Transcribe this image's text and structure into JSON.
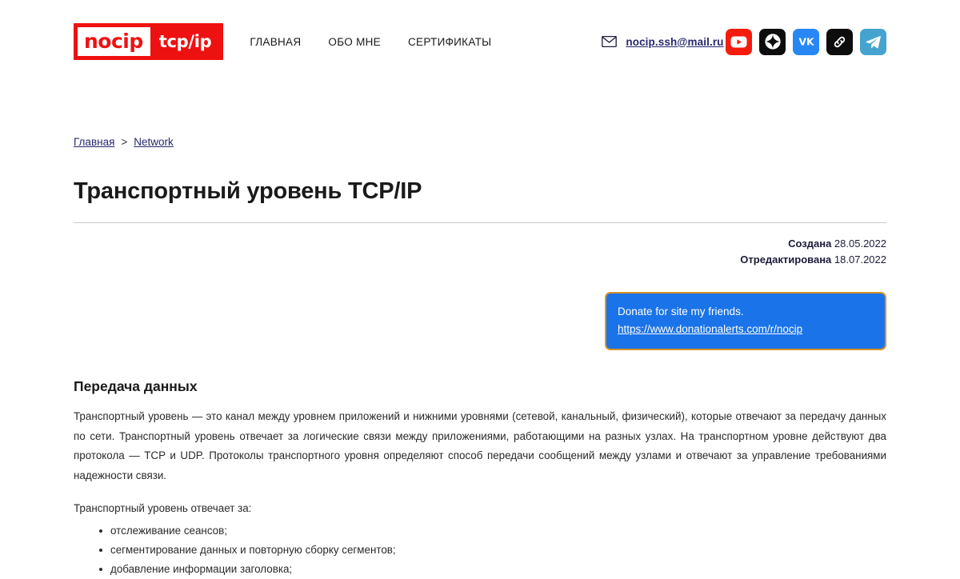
{
  "header": {
    "logo": {
      "main": "nocip",
      "sub": "tcp/ip",
      "bg_color": "#ee1111"
    },
    "nav": [
      {
        "label": "ГЛАВНАЯ"
      },
      {
        "label": "ОБО МНЕ"
      },
      {
        "label": "СЕРТИФИКАТЫ"
      }
    ],
    "email": {
      "icon": "envelope-icon",
      "address": "nocip.ssh@mail.ru",
      "color": "#28286e"
    },
    "socials": [
      {
        "name": "youtube",
        "color": "#f61c0d"
      },
      {
        "name": "dzen",
        "color": "#0d0d0d"
      },
      {
        "name": "vk",
        "color": "#2787f5"
      },
      {
        "name": "link",
        "color": "#0d0d0d"
      },
      {
        "name": "telegram",
        "color": "#45a4cf"
      }
    ]
  },
  "breadcrumb": {
    "home": "Главная",
    "separator": ">",
    "current": "Network"
  },
  "article": {
    "title": "Транспортный уровень TCP/IP",
    "meta": {
      "created_label": "Создана",
      "created_value": "28.05.2022",
      "edited_label": "Отредактирована",
      "edited_value": "18.07.2022"
    },
    "donate": {
      "text": "Donate for site my friends.",
      "url": "https://www.donationalerts.com/r/nocip",
      "bg_color": "#1a73e8",
      "border_color": "#d9952a"
    },
    "section_heading": "Передача данных",
    "paragraph": "Транспортный уровень — это канал между уровнем приложений и нижними уровнями (сетевой, канальный, физический), которые отвечают за передачу данных по сети. Транспортный уровень отвечает за логические связи между приложениями, работающими на разных узлах. На транспортном уровне действуют два протокола — TCP и UDP. Протоколы транспортного уровня определяют способ передачи сообщений между узлами и отвечают за управление требованиями надежности связи.",
    "list_intro": "Транспортный уровень отвечает за:",
    "list_items": [
      "отслеживание сеансов;",
      "сегментирование данных и повторную сборку сегментов;",
      "добавление информации заголовка;"
    ]
  }
}
